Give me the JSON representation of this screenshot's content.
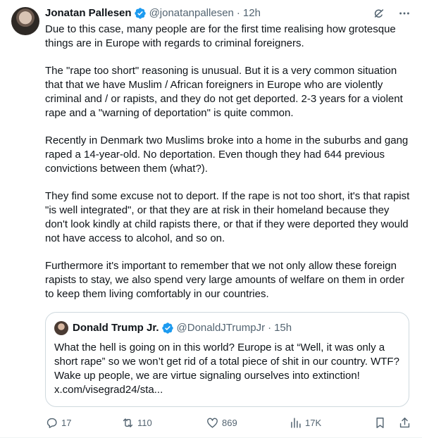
{
  "author": {
    "name": "Jonatan Pallesen",
    "handle": "@jonatanpallesen",
    "separator": "·",
    "time": "12h"
  },
  "body": [
    "Due to this case, many people are for the first time realising how grotesque things are in Europe with regards to criminal foreigners.",
    "The \"rape too short\" reasoning is unusual. But it is a very common situation that that we have Muslim / African foreigners in Europe who are violently criminal and / or rapists, and they do not get deported. 2-3 years for a violent rape and a \"warning of deportation\" is quite common.",
    "Recently in Denmark two Muslims broke into a home in the suburbs and gang raped a 14-year-old. No deportation. Even though they had 644 previous convictions between them (what?).",
    "They find some excuse not to deport. If the rape is not too short, it's that rapist \"is well integrated\", or that they are at risk in their homeland because they don't look kindly at child rapists there, or that if they were deported they would not have access to alcohol, and so on.",
    "Furthermore it's important to remember that we not only allow these foreign rapists to stay, we also spend very large amounts of welfare on them in order to keep them living comfortably in our countries."
  ],
  "quote": {
    "name": "Donald Trump Jr.",
    "handle": "@DonaldJTrumpJr",
    "separator": "·",
    "time": "15h",
    "text": "What the hell is going on in this world? Europe is at “Well, it was only a short rape” so we won’t get rid of a total piece of shit in our country. WTF? Wake up people, we are virtue signaling ourselves into extinction! x.com/visegrad24/sta..."
  },
  "stats": {
    "replies": "17",
    "reposts": "110",
    "likes": "869",
    "views": "17K"
  },
  "icons": {
    "verified": "verified-badge-icon",
    "grok": "grok-icon",
    "more": "more-icon",
    "reply": "reply-icon",
    "repost": "repost-icon",
    "like": "like-icon",
    "views": "views-icon",
    "bookmark": "bookmark-icon",
    "share": "share-icon"
  },
  "colors": {
    "verified": "#1d9bf0",
    "secondary_text": "#536471",
    "border": "#cfd9de"
  }
}
